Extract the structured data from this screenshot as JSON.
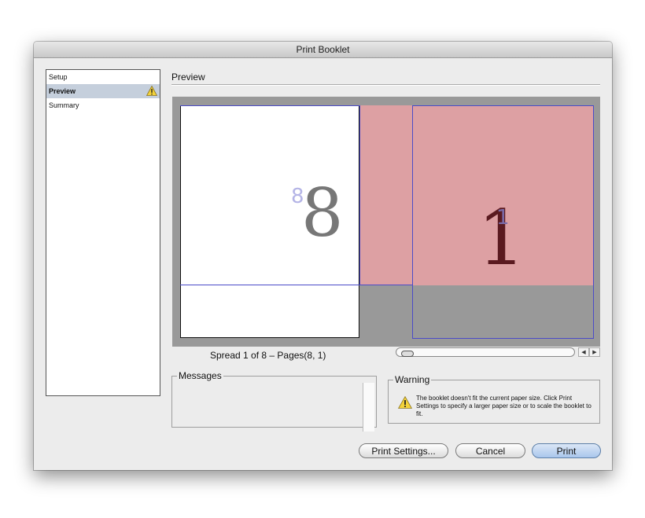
{
  "window": {
    "title": "Print Booklet"
  },
  "sidebar": {
    "items": [
      {
        "label": "Setup",
        "active": false,
        "warning": false
      },
      {
        "label": "Preview",
        "active": true,
        "warning": true
      },
      {
        "label": "Summary",
        "active": false,
        "warning": false
      }
    ]
  },
  "section": {
    "title": "Preview"
  },
  "preview": {
    "left_page": {
      "big_number": "8",
      "small_number": "8"
    },
    "right_page": {
      "big_number": "1",
      "small_number": "1"
    },
    "spread_label": "Spread 1 of 8 – Pages(8, 1)"
  },
  "messages": {
    "legend": "Messages"
  },
  "warning": {
    "legend": "Warning",
    "text": "The booklet doesn't fit the current paper size. Click Print Settings to specify a larger paper size or to scale the booklet to fit."
  },
  "buttons": {
    "print_settings": "Print Settings...",
    "cancel": "Cancel",
    "print": "Print"
  },
  "colors": {
    "overflow_pink": "#dda0a3",
    "pasteboard_gray": "#999999",
    "guide_blue": "#4b4bc8"
  }
}
